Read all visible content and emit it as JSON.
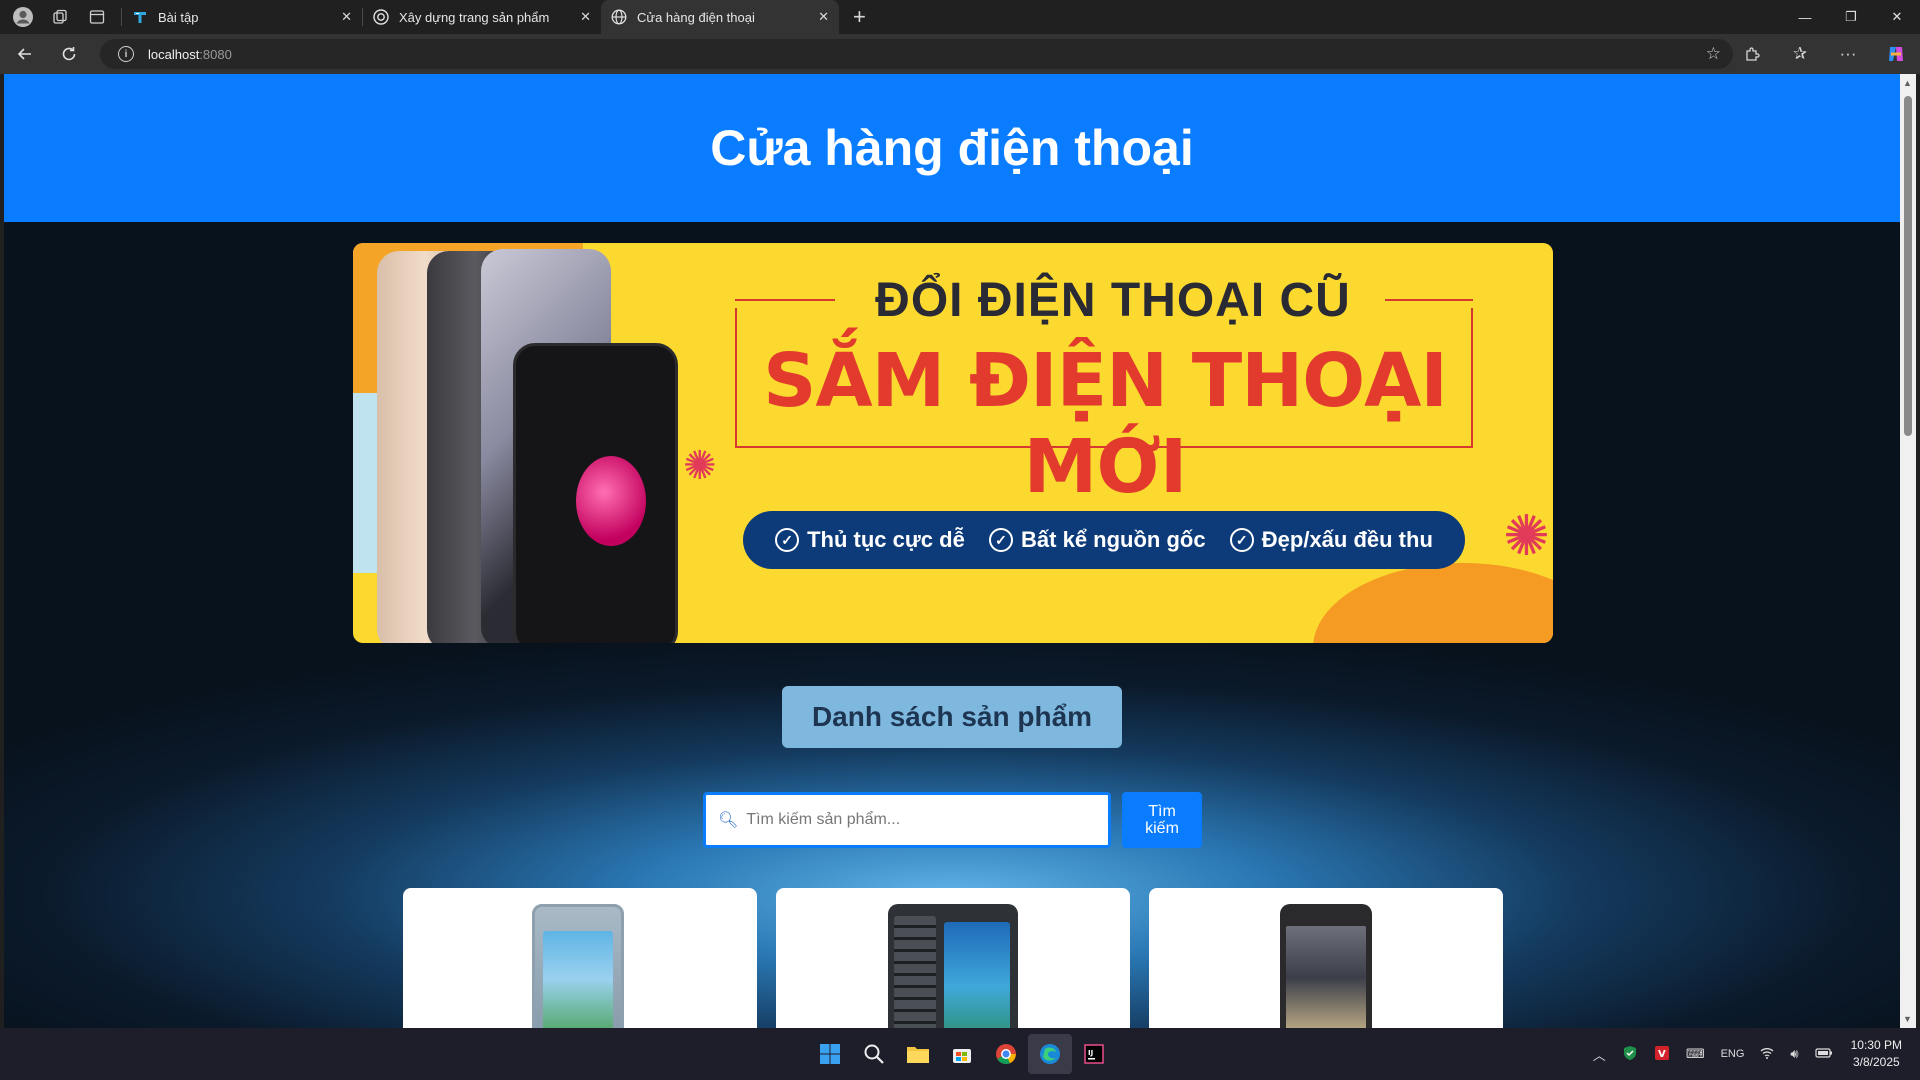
{
  "browser": {
    "tabs": [
      {
        "title": "Bài tập",
        "active": false
      },
      {
        "title": "Xây dựng trang sản phẩm",
        "active": false
      },
      {
        "title": "Cửa hàng điện thoại",
        "active": true
      }
    ],
    "url_host": "localhost",
    "url_port": ":8080"
  },
  "page": {
    "header_title": "Cửa hàng điện thoại",
    "banner": {
      "line1": "ĐỔI ĐIỆN THOẠI CŨ",
      "line2": "SẮM ĐIỆN THOẠI MỚI",
      "features": [
        "Thủ tục cực dễ",
        "Bất kể nguồn gốc",
        "Đẹp/xấu đều thu"
      ]
    },
    "section_title": "Danh sách sản phẩm",
    "search": {
      "placeholder": "Tìm kiếm sản phẩm...",
      "button_label": "Tìm kiếm"
    },
    "products_visible": 3
  },
  "taskbar": {
    "lang": "ENG",
    "time": "10:30 PM",
    "date": "3/8/2025"
  },
  "colors": {
    "header_bg": "#0a7cff",
    "banner_bg": "#fcd92f",
    "banner_accent": "#e23b2e"
  }
}
